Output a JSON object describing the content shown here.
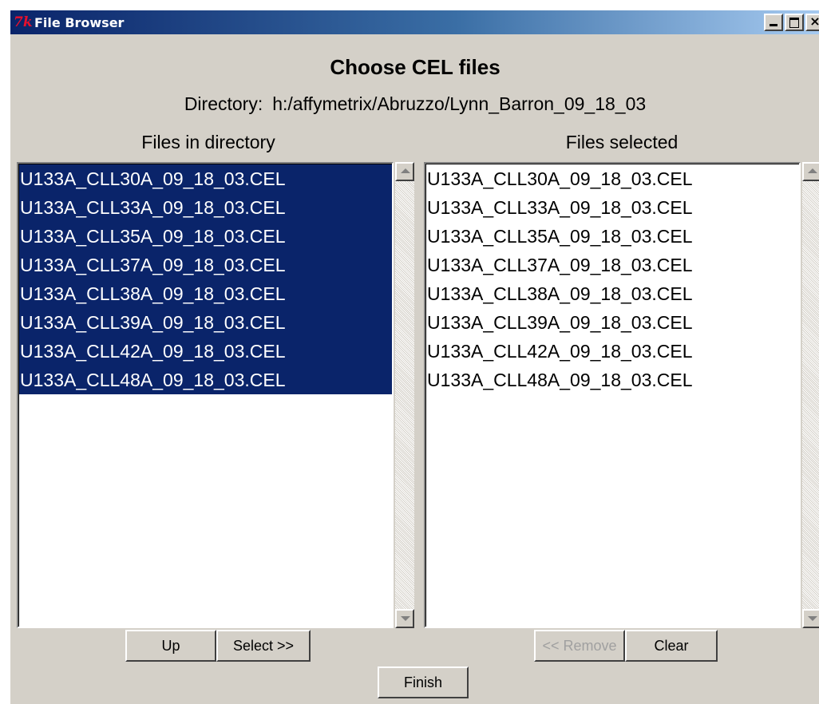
{
  "window": {
    "title": "File Browser",
    "logo_text": "7k"
  },
  "dialog": {
    "heading": "Choose CEL files",
    "directory_label": "Directory:",
    "directory_path": "h:/affymetrix/Abruzzo/Lynn_Barron_09_18_03"
  },
  "left_panel": {
    "label": "Files in directory",
    "items": [
      "U133A_CLL30A_09_18_03.CEL",
      "U133A_CLL33A_09_18_03.CEL",
      "U133A_CLL35A_09_18_03.CEL",
      "U133A_CLL37A_09_18_03.CEL",
      "U133A_CLL38A_09_18_03.CEL",
      "U133A_CLL39A_09_18_03.CEL",
      "U133A_CLL42A_09_18_03.CEL",
      "U133A_CLL48A_09_18_03.CEL"
    ]
  },
  "right_panel": {
    "label": "Files selected",
    "items": [
      "U133A_CLL30A_09_18_03.CEL",
      "U133A_CLL33A_09_18_03.CEL",
      "U133A_CLL35A_09_18_03.CEL",
      "U133A_CLL37A_09_18_03.CEL",
      "U133A_CLL38A_09_18_03.CEL",
      "U133A_CLL39A_09_18_03.CEL",
      "U133A_CLL42A_09_18_03.CEL",
      "U133A_CLL48A_09_18_03.CEL"
    ]
  },
  "buttons": {
    "up": "Up",
    "select": "Select >>",
    "remove": "<< Remove",
    "clear": "Clear",
    "finish": "Finish"
  },
  "colors": {
    "selection_bg": "#0a246a",
    "window_bg": "#d4d0c8"
  }
}
